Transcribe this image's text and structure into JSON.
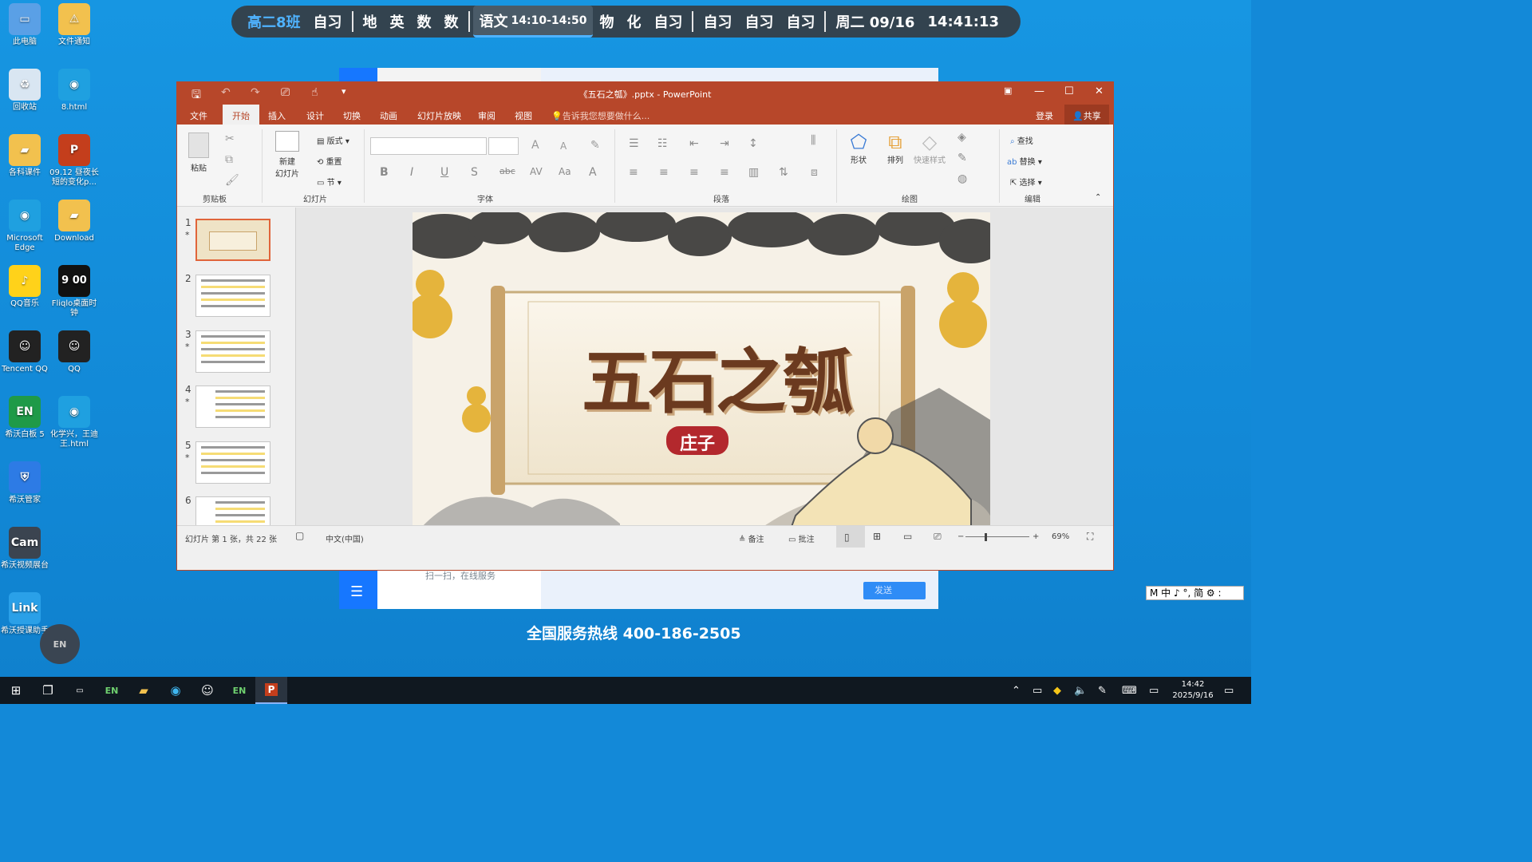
{
  "desktop": {
    "icons": [
      {
        "label": "此电脑",
        "icon": "computer-icon"
      },
      {
        "label": "文件通知",
        "icon": "folder-warning-icon"
      },
      {
        "label": "回收站",
        "icon": "recycle-bin-icon"
      },
      {
        "label": "8.html",
        "icon": "edge-icon"
      },
      {
        "label": "各科课件",
        "icon": "folder-icon"
      },
      {
        "label": "09.12 昼夜长短的变化p...",
        "icon": "pptx-icon"
      },
      {
        "label": "Microsoft Edge",
        "icon": "edge-icon"
      },
      {
        "label": "Download",
        "icon": "folder-icon"
      },
      {
        "label": "QQ音乐",
        "icon": "qq-music-icon"
      },
      {
        "label": "Fliqlo桌面时钟",
        "icon": "clock-icon"
      },
      {
        "label": "Tencent QQ",
        "icon": "qq-icon"
      },
      {
        "label": "QQ",
        "icon": "qq-icon"
      },
      {
        "label": "希沃白板 5",
        "icon": "easinote-icon"
      },
      {
        "label": "化学兴，王迪王.html",
        "icon": "edge-icon"
      },
      {
        "label": "希沃管家",
        "icon": "shield-icon"
      },
      {
        "label": "希沃视频展台",
        "icon": "camera-icon"
      },
      {
        "label": "希沃授课助手",
        "icon": "link-icon"
      }
    ],
    "fliqlo_time": "9 00",
    "hotline": "全国服务热线 400-186-2505",
    "bg_hint": "扫一扫，在线服务",
    "bg_send": "发送"
  },
  "schedule": {
    "class_name": "高二8班",
    "items_a": [
      "自习"
    ],
    "items_b": [
      "地",
      "英",
      "数",
      "数"
    ],
    "current_subject": "语文",
    "current_time": "14:10-14:50",
    "items_c": [
      "物",
      "化",
      "自习"
    ],
    "items_d": [
      "自习",
      "自习",
      "自习"
    ],
    "date": "周二 09/16",
    "time": "14:41:13"
  },
  "ppt": {
    "window_title": "《五石之瓠》.pptx - PowerPoint",
    "tabs": [
      "文件",
      "开始",
      "插入",
      "设计",
      "切换",
      "动画",
      "幻灯片放映",
      "审阅",
      "视图"
    ],
    "tell_me": "告诉我您想要做什么...",
    "login": "登录",
    "share": "共享",
    "ribbon": {
      "paste": "粘贴",
      "clipboard": "剪贴板",
      "new_slide": "新建\n幻灯片",
      "layout": "版式",
      "reset": "重置",
      "section": "节",
      "slides": "幻灯片",
      "font": "字体",
      "paragraph": "段落",
      "shapes": "形状",
      "arrange": "排列",
      "quick_styles": "快速样式",
      "drawing": "绘图",
      "find": "查找",
      "replace": "替换",
      "select": "选择",
      "editing": "编辑"
    },
    "thumbnails": [
      "1",
      "2",
      "3",
      "4",
      "5",
      "6"
    ],
    "slide": {
      "title": "五石之瓠",
      "author": "庄子"
    },
    "status": {
      "slide_info": "幻灯片 第 1 张，共 22 张",
      "language": "中文(中国)",
      "notes": "备注",
      "comments": "批注",
      "zoom": "69%"
    }
  },
  "taskbar": {
    "time": "14:42",
    "date": "2025/9/16"
  },
  "ime": "M 中 ♪ °, 简 ⚙ :"
}
